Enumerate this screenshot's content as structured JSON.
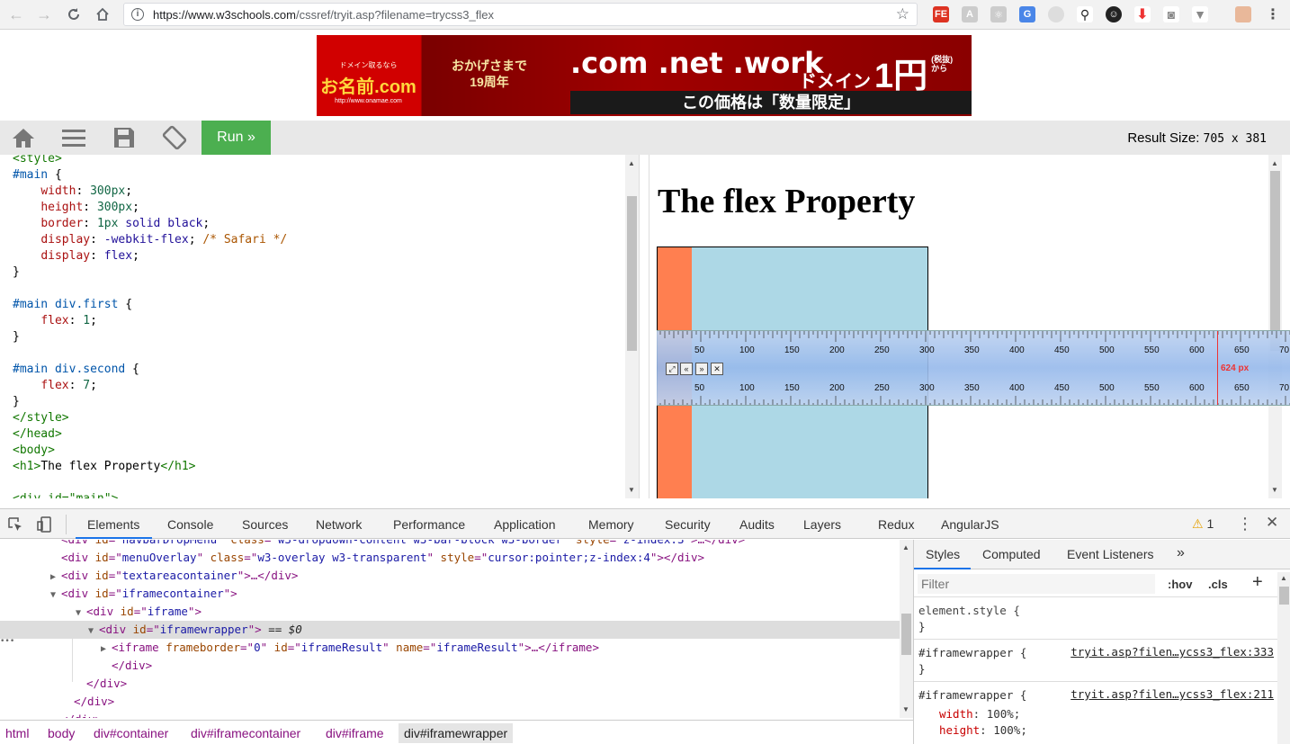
{
  "browser": {
    "url_prefix": "https://www.w3schools.com",
    "url_path": "/cssref/tryit.asp?filename=trycss3_flex",
    "extension_icons": [
      "FE",
      "A",
      "",
      "G",
      "",
      "",
      "",
      "",
      "",
      "",
      ""
    ]
  },
  "ad": {
    "logo_small": "ドメイン取るなら",
    "logo_name": "お名前.com",
    "logo_url": "http://www.onamae.com",
    "anniversary_line1": "おかげさまで",
    "anniversary_line2": "19周年",
    "domains": ".com .net .work",
    "price_prefix": "ドメイン",
    "price_big": "1円",
    "price_note1": "(税抜)",
    "price_note2": "から",
    "bottom_text": "この価格は「数量限定」"
  },
  "toolbar": {
    "run_label": "Run »",
    "result_size_label": "Result Size:",
    "result_size_value": "705 x 381"
  },
  "editor": {
    "lines": [
      [
        [
          "tag",
          "<style>"
        ]
      ],
      [
        [
          "sel",
          "#main"
        ],
        [
          "br",
          " {"
        ]
      ],
      [
        [
          "sp",
          "    "
        ],
        [
          "prop",
          "width"
        ],
        [
          "br",
          ": "
        ],
        [
          "num",
          "300px"
        ],
        [
          "br",
          ";"
        ]
      ],
      [
        [
          "sp",
          "    "
        ],
        [
          "prop",
          "height"
        ],
        [
          "br",
          ": "
        ],
        [
          "num",
          "300px"
        ],
        [
          "br",
          ";"
        ]
      ],
      [
        [
          "sp",
          "    "
        ],
        [
          "prop",
          "border"
        ],
        [
          "br",
          ": "
        ],
        [
          "num",
          "1px"
        ],
        [
          "br",
          " "
        ],
        [
          "val",
          "solid"
        ],
        [
          "br",
          " "
        ],
        [
          "val",
          "black"
        ],
        [
          "br",
          ";"
        ]
      ],
      [
        [
          "sp",
          "    "
        ],
        [
          "prop",
          "display"
        ],
        [
          "br",
          ": "
        ],
        [
          "val",
          "-webkit-flex"
        ],
        [
          "br",
          "; "
        ],
        [
          "com",
          "/* Safari */"
        ]
      ],
      [
        [
          "sp",
          "    "
        ],
        [
          "prop",
          "display"
        ],
        [
          "br",
          ": "
        ],
        [
          "val",
          "flex"
        ],
        [
          "br",
          ";"
        ]
      ],
      [
        [
          "br",
          "}"
        ]
      ],
      [
        [
          "br",
          ""
        ]
      ],
      [
        [
          "sel",
          "#main div.first"
        ],
        [
          "br",
          " {"
        ]
      ],
      [
        [
          "sp",
          "    "
        ],
        [
          "prop",
          "flex"
        ],
        [
          "br",
          ": "
        ],
        [
          "num",
          "1"
        ],
        [
          "br",
          ";"
        ]
      ],
      [
        [
          "br",
          "}"
        ]
      ],
      [
        [
          "br",
          ""
        ]
      ],
      [
        [
          "sel",
          "#main div.second"
        ],
        [
          "br",
          " {"
        ]
      ],
      [
        [
          "sp",
          "    "
        ],
        [
          "prop",
          "flex"
        ],
        [
          "br",
          ": "
        ],
        [
          "num",
          "7"
        ],
        [
          "br",
          ";"
        ]
      ],
      [
        [
          "br",
          "}"
        ]
      ],
      [
        [
          "tag",
          "</style>"
        ]
      ],
      [
        [
          "tag",
          "</head>"
        ]
      ],
      [
        [
          "tag",
          "<body>"
        ]
      ],
      [
        [
          "tag",
          "<h1>"
        ],
        [
          "br",
          "The flex Property"
        ],
        [
          "tag",
          "</h1>"
        ]
      ],
      [
        [
          "br",
          ""
        ]
      ],
      [
        [
          "tag",
          "<div id=\"main\">"
        ]
      ]
    ]
  },
  "result": {
    "heading": "The flex Property",
    "flex_first_ratio": 1,
    "flex_second_ratio": 7
  },
  "ruler": {
    "top_labels": [
      "50",
      "100",
      "150",
      "200",
      "250",
      "300",
      "350",
      "400",
      "450",
      "500",
      "550",
      "600",
      "650",
      "70"
    ],
    "bottom_labels": [
      "50",
      "100",
      "150",
      "200",
      "250",
      "300",
      "350",
      "400",
      "450",
      "500",
      "550",
      "600",
      "650",
      "70"
    ],
    "measure": "624 px",
    "buttons": [
      "⤢",
      "«",
      "»",
      "✕"
    ]
  },
  "devtools": {
    "tabs": [
      "Elements",
      "Console",
      "Sources",
      "Network",
      "Performance",
      "Application",
      "Memory",
      "Security",
      "Audits",
      "Layers",
      "Redux",
      "AngularJS"
    ],
    "warning_count": "1",
    "dom_lines": [
      {
        "indent": 4,
        "tri": "",
        "parts": [
          [
            "tag",
            "<div "
          ],
          [
            "an",
            "id"
          ],
          [
            "tag",
            "=\""
          ],
          [
            "av",
            "navbarDropMenu"
          ],
          [
            "tag",
            "\" "
          ],
          [
            "an",
            "class"
          ],
          [
            "tag",
            "=\""
          ],
          [
            "av",
            "w3-dropdown-content w3-bar-block w3-border"
          ],
          [
            "tag",
            "\" "
          ],
          [
            "an",
            "style"
          ],
          [
            "tag",
            "=\""
          ],
          [
            "av",
            "z-index:3"
          ],
          [
            "tag",
            "\">…</div>"
          ]
        ]
      },
      {
        "indent": 4,
        "tri": "",
        "parts": [
          [
            "tag",
            "<div "
          ],
          [
            "an",
            "id"
          ],
          [
            "tag",
            "=\""
          ],
          [
            "av",
            "menuOverlay"
          ],
          [
            "tag",
            "\" "
          ],
          [
            "an",
            "class"
          ],
          [
            "tag",
            "=\""
          ],
          [
            "av",
            "w3-overlay w3-transparent"
          ],
          [
            "tag",
            "\" "
          ],
          [
            "an",
            "style"
          ],
          [
            "tag",
            "=\""
          ],
          [
            "av",
            "cursor:pointer;z-index:4"
          ],
          [
            "tag",
            "\"></div>"
          ]
        ]
      },
      {
        "indent": 4,
        "tri": "▶",
        "parts": [
          [
            "tag",
            "<div "
          ],
          [
            "an",
            "id"
          ],
          [
            "tag",
            "=\""
          ],
          [
            "av",
            "textareacontainer"
          ],
          [
            "tag",
            "\">…</div>"
          ]
        ]
      },
      {
        "indent": 4,
        "tri": "▼",
        "parts": [
          [
            "tag",
            "<div "
          ],
          [
            "an",
            "id"
          ],
          [
            "tag",
            "=\""
          ],
          [
            "av",
            "iframecontainer"
          ],
          [
            "tag",
            "\">"
          ]
        ]
      },
      {
        "indent": 6,
        "tri": "▼",
        "parts": [
          [
            "tag",
            "<div "
          ],
          [
            "an",
            "id"
          ],
          [
            "tag",
            "=\""
          ],
          [
            "av",
            "iframe"
          ],
          [
            "tag",
            "\">"
          ]
        ]
      },
      {
        "indent": 7,
        "tri": "▼",
        "parts": [
          [
            "tag",
            "<div "
          ],
          [
            "an",
            "id"
          ],
          [
            "tag",
            "=\""
          ],
          [
            "av",
            "iframewrapper"
          ],
          [
            "tag",
            "\">"
          ],
          [
            "tx",
            " == $0"
          ]
        ],
        "selected": true
      },
      {
        "indent": 8,
        "tri": "▶",
        "parts": [
          [
            "tag",
            "<iframe "
          ],
          [
            "an",
            "frameborder"
          ],
          [
            "tag",
            "=\""
          ],
          [
            "av",
            "0"
          ],
          [
            "tag",
            "\" "
          ],
          [
            "an",
            "id"
          ],
          [
            "tag",
            "=\""
          ],
          [
            "av",
            "iframeResult"
          ],
          [
            "tag",
            "\" "
          ],
          [
            "an",
            "name"
          ],
          [
            "tag",
            "=\""
          ],
          [
            "av",
            "iframeResult"
          ],
          [
            "tag",
            "\">…</iframe>"
          ]
        ]
      },
      {
        "indent": 8,
        "tri": "",
        "parts": [
          [
            "tag",
            "</div>"
          ]
        ]
      },
      {
        "indent": 6,
        "tri": "",
        "parts": [
          [
            "tag",
            "</div>"
          ]
        ]
      },
      {
        "indent": 5,
        "tri": "",
        "parts": [
          [
            "tag",
            "</div>"
          ]
        ]
      },
      {
        "indent": 4,
        "tri": "",
        "parts": [
          [
            "tag",
            "</div>"
          ]
        ]
      }
    ],
    "breadcrumbs": [
      "html",
      "body",
      "div#container",
      "div#iframecontainer",
      "div#iframe",
      "div#iframewrapper"
    ],
    "styles_tabs": [
      "Styles",
      "Computed",
      "Event Listeners",
      "»"
    ],
    "filter_placeholder": "Filter",
    "hov_label": ":hov",
    "cls_label": ".cls",
    "plus_label": "+",
    "rules": {
      "element_style_open": "element.style {",
      "element_style_close": "}",
      "rule1_selector": "#iframewrapper {",
      "rule1_link": "tryit.asp?filen…ycss3_flex:333",
      "rule1_close": "}",
      "rule2_selector": "#iframewrapper {",
      "rule2_link": "tryit.asp?filen…ycss3_flex:211",
      "rule2_prop1_name": "width",
      "rule2_prop1_value": "100%;",
      "rule2_prop2_name": "height",
      "rule2_prop2_value": "100%;"
    }
  }
}
